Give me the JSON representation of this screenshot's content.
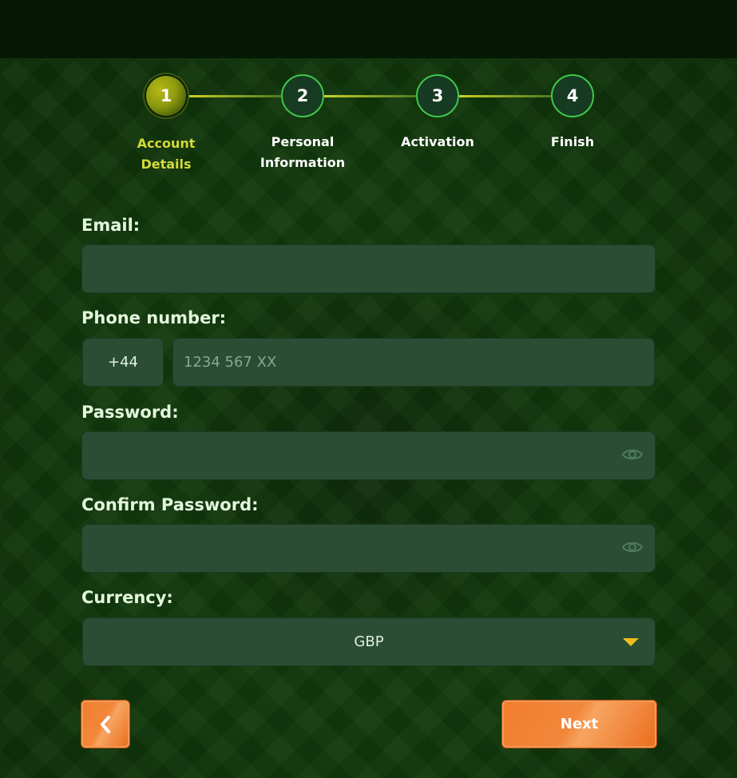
{
  "stepper": {
    "steps": [
      {
        "number": "1",
        "label": "Account Details",
        "state": "active"
      },
      {
        "number": "2",
        "label": "Personal Information",
        "state": "inactive"
      },
      {
        "number": "3",
        "label": "Activation",
        "state": "inactive"
      },
      {
        "number": "4",
        "label": "Finish",
        "state": "inactive"
      }
    ]
  },
  "form": {
    "email": {
      "label": "Email:",
      "value": "",
      "placeholder": ""
    },
    "phone": {
      "label": "Phone number:",
      "prefix": "+44",
      "value": "",
      "placeholder": "1234 567 XX"
    },
    "password": {
      "label": "Password:",
      "value": "",
      "icon": "eye-icon"
    },
    "confirm_password": {
      "label": "Confirm Password:",
      "value": "",
      "icon": "eye-icon"
    },
    "currency": {
      "label": "Currency:",
      "selected": "GBP",
      "icon": "chevron-down-icon"
    }
  },
  "actions": {
    "back_icon": "chevron-left-icon",
    "next_label": "Next"
  },
  "colors": {
    "background": "#0f2e0a",
    "field": "#2a4d33",
    "accent_active": "#d5d838",
    "step_border": "#3fc64c",
    "button": "#f07e2d",
    "caret": "#efbe1b"
  }
}
